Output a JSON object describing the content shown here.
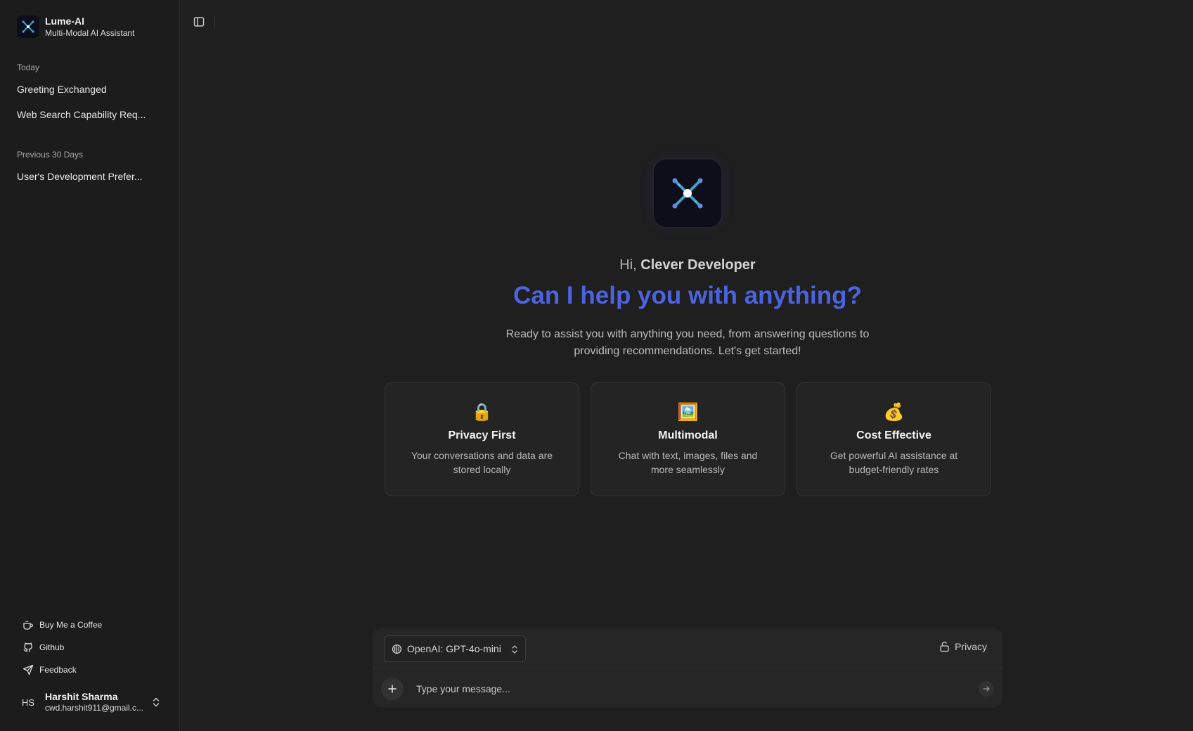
{
  "app": {
    "name": "Lume-AI",
    "subtitle": "Multi-Modal AI Assistant"
  },
  "sidebar": {
    "groups": [
      {
        "label": "Today",
        "items": [
          "Greeting Exchanged",
          "Web Search Capability Req..."
        ]
      },
      {
        "label": "Previous 30 Days",
        "items": [
          "User's Development Prefer..."
        ]
      }
    ],
    "footer_links": [
      {
        "label": "Buy Me a Coffee",
        "icon": "coffee-icon"
      },
      {
        "label": "Github",
        "icon": "github-icon"
      },
      {
        "label": "Feedback",
        "icon": "send-icon"
      }
    ],
    "user": {
      "initials": "HS",
      "name": "Harshit Sharma",
      "email": "cwd.harshit911@gmail.c..."
    }
  },
  "main": {
    "greeting_prefix": "Hi,",
    "greeting_name": "Clever Developer",
    "headline": "Can I help you with anything?",
    "intro": "Ready to assist you with anything you need, from answering questions to providing recommendations. Let's get started!",
    "cards": [
      {
        "icon": "🔒",
        "title": "Privacy First",
        "description": "Your conversations and data are stored locally"
      },
      {
        "icon": "🖼️",
        "title": "Multimodal",
        "description": "Chat with text, images, files and more seamlessly"
      },
      {
        "icon": "💰",
        "title": "Cost Effective",
        "description": "Get powerful AI assistance at budget-friendly rates"
      }
    ]
  },
  "composer": {
    "model": "OpenAI: GPT-4o-mini",
    "privacy_label": "Privacy",
    "placeholder": "Type your message..."
  },
  "colors": {
    "accent": "#4c63e0",
    "background": "#1f1f1f",
    "sidebar": "#1c1c1c",
    "card": "#242424"
  }
}
